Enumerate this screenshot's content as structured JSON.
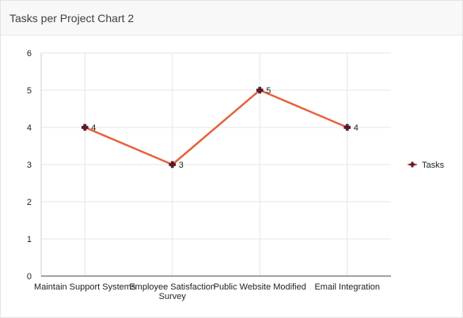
{
  "panel": {
    "title": "Tasks per Project Chart 2"
  },
  "chart_data": {
    "type": "line",
    "categories": [
      [
        "Maintain Support Systems"
      ],
      [
        "Employee Satisfaction",
        "Survey"
      ],
      [
        "Public Website Modified"
      ],
      [
        "Email Integration"
      ]
    ],
    "series": [
      {
        "name": "Tasks",
        "values": [
          4,
          3,
          5,
          4
        ],
        "color": "#e8603c",
        "marker_color": "#5a1a2a"
      }
    ],
    "ylim": [
      0,
      6
    ],
    "yticks": [
      0,
      1,
      2,
      3,
      4,
      5,
      6
    ],
    "grid": true,
    "data_labels": true,
    "legend": "right"
  }
}
